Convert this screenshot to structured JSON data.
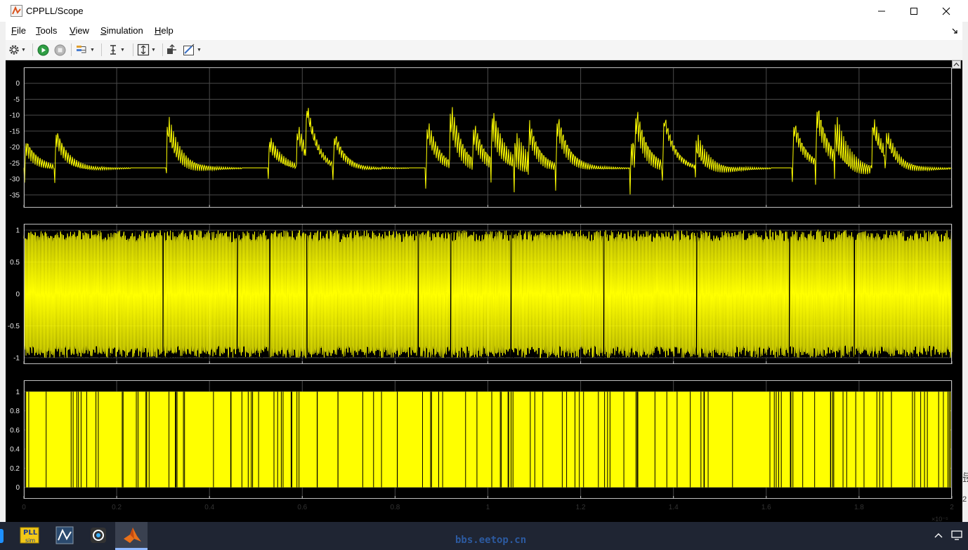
{
  "window": {
    "title": "CPPLL/Scope",
    "controls": [
      "minimize",
      "maximize",
      "close"
    ]
  },
  "menu": [
    {
      "label": "File",
      "underline": "F",
      "rest": "ile"
    },
    {
      "label": "Tools",
      "underline": "T",
      "rest": "ools"
    },
    {
      "label": "View",
      "underline": "V",
      "rest": "iew"
    },
    {
      "label": "Simulation",
      "underline": "S",
      "rest": "imulation"
    },
    {
      "label": "Help",
      "underline": "H",
      "rest": "elp"
    }
  ],
  "toolbar": {
    "items": [
      "gear-icon",
      "run-icon",
      "stop-icon",
      "signal-icon",
      "cursor-icon",
      "scale-icon",
      "restore-icon",
      "style-icon"
    ]
  },
  "colors": {
    "trace": "#ffff00",
    "plot_bg": "#000000",
    "grid": "#4a4a4a",
    "axes_border": "#bfbfbf",
    "tick_text": "#e8e8e8"
  },
  "chart_data": [
    {
      "type": "line",
      "x_range": [
        0,
        2
      ],
      "ylim": [
        -39,
        5
      ],
      "yticks": [
        "0",
        "-5",
        "-10",
        "-15",
        "-20",
        "-25",
        "-30",
        "-35"
      ],
      "grid": true,
      "series": [
        {
          "color": "#ffff00",
          "baseline": -26.5,
          "spike_peaks_x": [
            0.005,
            0.07,
            0.31,
            0.53,
            0.59,
            0.61,
            0.67,
            0.87,
            0.92,
            0.97,
            1.01,
            1.06,
            1.09,
            1.15,
            1.31,
            1.32,
            1.38,
            1.45,
            1.66,
            1.71,
            1.75,
            1.83,
            1.86
          ]
        }
      ]
    },
    {
      "type": "line",
      "x_range": [
        0,
        2
      ],
      "ylim": [
        -1.1,
        1.1
      ],
      "yticks": [
        "1",
        "0.5",
        "0",
        "-0.5",
        "-1"
      ],
      "grid": true,
      "series": [
        {
          "color": "#ffff00",
          "range": [
            -1,
            1
          ]
        }
      ]
    },
    {
      "type": "area",
      "x_range": [
        0,
        2
      ],
      "ylim": [
        -0.12,
        1.12
      ],
      "yticks": [
        "1",
        "0.8",
        "0.6",
        "0.4",
        "0.2",
        "0"
      ],
      "xticks": [
        "0",
        "0.2",
        "0.4",
        "0.6",
        "0.8",
        "1",
        "1.2",
        "1.4",
        "1.6",
        "1.8",
        "2"
      ],
      "x_exponent": "×10⁻⁵",
      "grid": true,
      "series": [
        {
          "color": "#ffff00",
          "range": [
            0,
            1
          ]
        }
      ]
    }
  ],
  "taskbar": {
    "apps": [
      "pll-sim-icon",
      "adc-tool-icon",
      "chip-tool-icon",
      "matlab-icon"
    ],
    "pll_label_top": "PLL",
    "pll_label_bottom": "sim",
    "watermark": "bbs.eetop.cn"
  },
  "right_edge_peek": [
    "与",
    "12",
    "2"
  ]
}
